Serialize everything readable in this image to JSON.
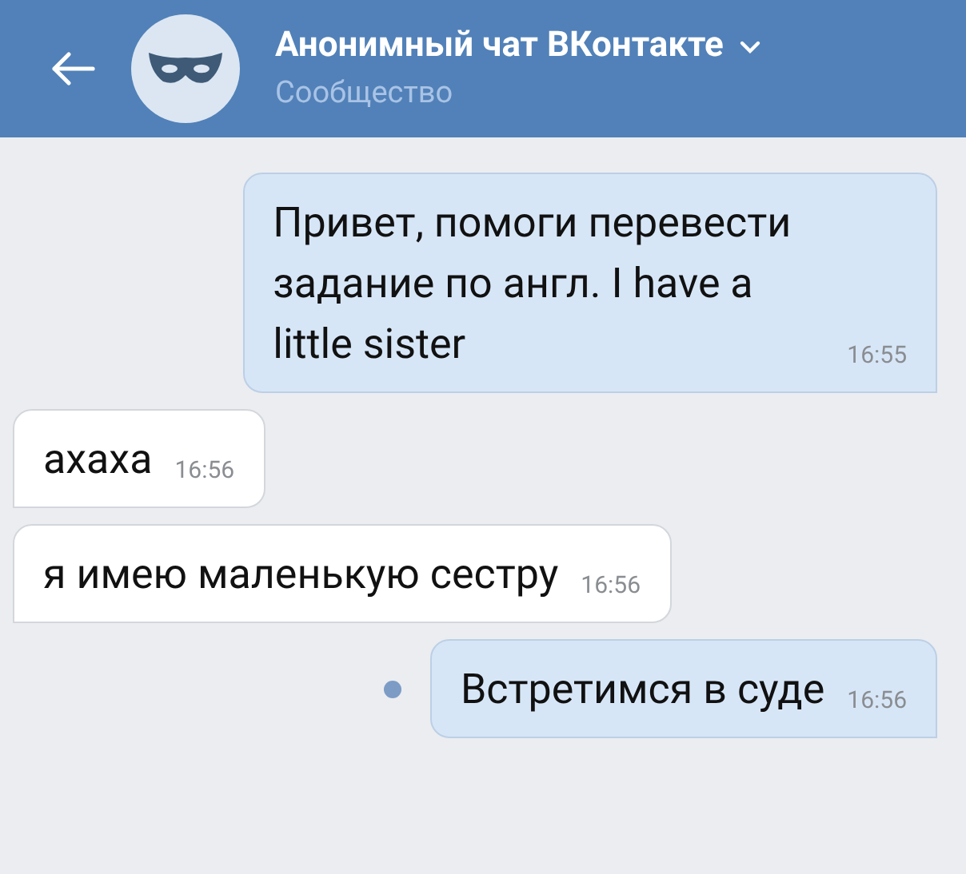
{
  "header": {
    "title": "Анонимный чат ВКонтакте",
    "subtitle": "Сообщество"
  },
  "messages": [
    {
      "kind": "outgoing",
      "text": "Привет, помоги перевести задание по англ. I have a little sister",
      "time": "16:55",
      "unread": false
    },
    {
      "kind": "incoming",
      "text": "ахаха",
      "time": "16:56",
      "unread": false
    },
    {
      "kind": "incoming",
      "text": "я имею маленькую сестру",
      "time": "16:56",
      "unread": false
    },
    {
      "kind": "outgoing",
      "text": "Встретимся в суде",
      "time": "16:56",
      "unread": true
    }
  ]
}
